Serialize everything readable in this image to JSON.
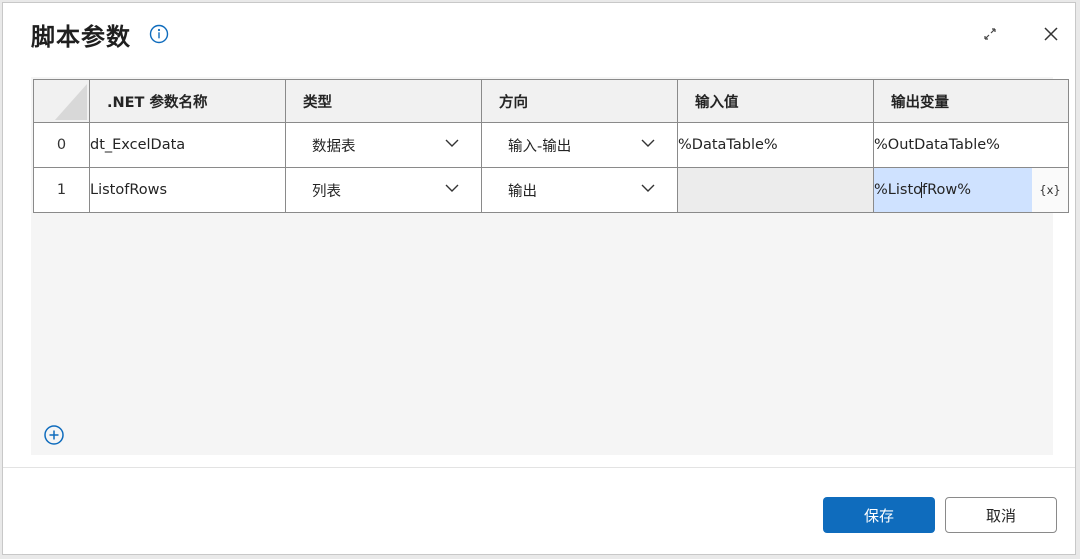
{
  "dialog": {
    "title": "脚本参数",
    "info_icon": "info-icon",
    "expand_icon": "expand-icon",
    "close_icon": "close-icon"
  },
  "table": {
    "headers": [
      ".NET 参数名称",
      "类型",
      "方向",
      "输入值",
      "输出变量"
    ],
    "rows": [
      {
        "index": "0",
        "name": "dt_ExcelData",
        "type": "数据表",
        "direction": "输入-输出",
        "input_value": "%DataTable%",
        "output_variable": "%OutDataTable%"
      },
      {
        "index": "1",
        "name": "ListofRows",
        "type": "列表",
        "direction": "输出",
        "input_value": "",
        "output_variable_before_caret": "%Listo",
        "output_variable_after_caret": "fRow%",
        "variable_button": "{x}"
      }
    ]
  },
  "add_icon": "plus-circle-icon",
  "footer": {
    "primary_label": "保存",
    "secondary_label": "取消"
  },
  "colors": {
    "accent": "#0f6cbd",
    "active_cell": "#cfe2ff"
  }
}
